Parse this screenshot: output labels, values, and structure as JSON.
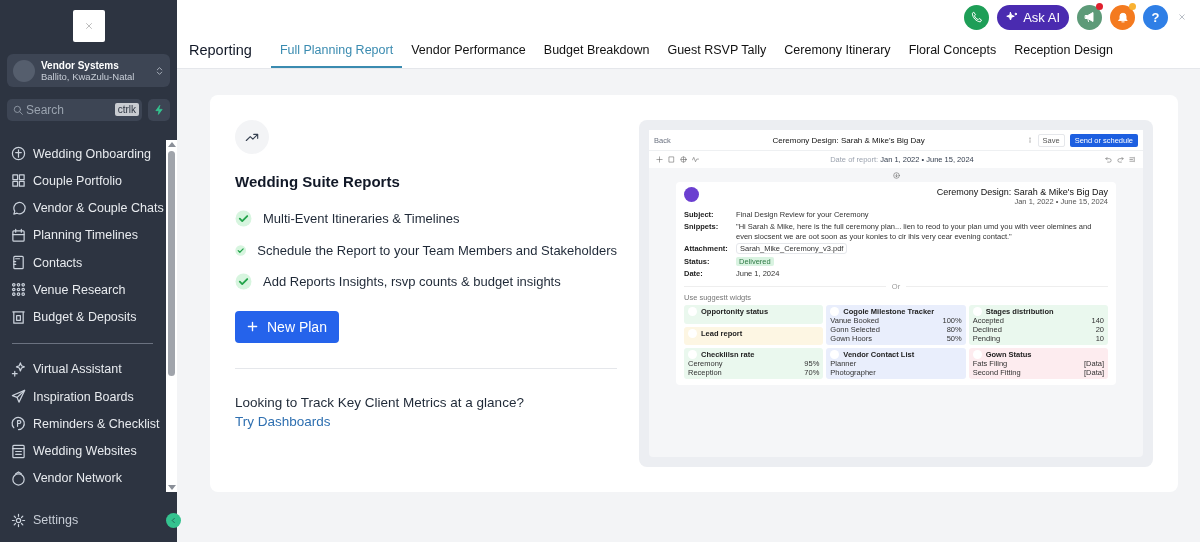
{
  "account": {
    "name": "Vendor Systems",
    "location": "Ballito, KwaZulu-Natal"
  },
  "search": {
    "placeholder": "Search",
    "shortcut": "ctrlk"
  },
  "nav": [
    {
      "items": [
        {
          "kind": "onboarding",
          "label": "Wedding Onboarding"
        },
        {
          "kind": "grid",
          "label": "Couple Portfolio"
        },
        {
          "kind": "chat",
          "label": "Vendor & Couple Chats"
        },
        {
          "kind": "calendar",
          "label": "Planning Timelines"
        },
        {
          "kind": "notebook",
          "label": "Contacts"
        },
        {
          "kind": "dots",
          "label": "Venue Research"
        },
        {
          "kind": "box",
          "label": "Budget & Deposits"
        }
      ]
    },
    {
      "items": [
        {
          "kind": "sparkle",
          "label": "Virtual Assistant"
        },
        {
          "kind": "send",
          "label": "Inspiration Boards"
        },
        {
          "kind": "clock",
          "label": "Reminders & Checklist"
        },
        {
          "kind": "page",
          "label": "Wedding Websites"
        },
        {
          "kind": "ring",
          "label": "Vendor Network"
        }
      ]
    }
  ],
  "settings": {
    "label": "Settings"
  },
  "actions": [
    {
      "kind": "phone"
    },
    {
      "kind": "ask_ai",
      "label": "Ask AI"
    },
    {
      "kind": "megaphone",
      "dot": true
    },
    {
      "kind": "bell",
      "dot": true
    },
    {
      "kind": "help",
      "label": "?"
    }
  ],
  "tabs": {
    "title": "Reporting",
    "items": [
      {
        "label": "Full Planning Report",
        "selected": true
      },
      {
        "label": "Vendor Performance",
        "selected": false
      },
      {
        "label": "Budget Breakdown",
        "selected": false
      },
      {
        "label": "Guest RSVP Tally",
        "selected": false
      },
      {
        "label": "Ceremony Itinerary",
        "selected": false
      },
      {
        "label": "Floral Concepts",
        "selected": false
      },
      {
        "label": "Reception Design",
        "selected": false
      }
    ]
  },
  "intro": {
    "heading": "Wedding Suite Reports",
    "features": [
      "Multi-Event Itineraries & Timelines",
      "Schedule the Report to your Team Members and Stakeholders",
      "Add Reports Insights, rsvp counts & budget insights"
    ],
    "button": "New Plan",
    "prompt": "Looking to Track Key Client Metrics at a glance?",
    "link": "Try Dashboards"
  },
  "preview": {
    "back": "Back",
    "title": "Ceremony Design: Sarah & Mike's Big Day",
    "save": "Save",
    "send": "Send or schedule",
    "date_label": "Date of report:",
    "date_range": "Jan 1, 2022 • June 15, 2024",
    "card": {
      "title": "Ceremony Design: Sarah & Mike's Big Day",
      "date_range": "Jan 1, 2022 • June 15, 2024",
      "fields": [
        {
          "kind": "text",
          "label": "Subject:",
          "value": "Final Design Review for your Ceremony"
        },
        {
          "kind": "text",
          "label": "Snippets:",
          "value": "\"Hi Sarah & Mike, here is the full ceremony plan... lien to reod to your plan umd you with veer olemines and even siocsent we are oot soon as your konies to cir ihis very cear evening contact.\""
        },
        {
          "kind": "file",
          "label": "Attachment:",
          "value": "Sarah_Mike_Ceremony_v3.pdf"
        },
        {
          "kind": "badge",
          "label": "Status:",
          "value": "Delivered"
        },
        {
          "kind": "text",
          "label": "Date:",
          "value": "June 1, 2024"
        }
      ],
      "divider": "Or",
      "widgets_label": "Use suggestt widgts",
      "widgets": [
        {
          "kind": "short",
          "title": "Opportonity status",
          "color": "#eaf8ee"
        },
        {
          "kind": "tall",
          "title": "Cogole Milestone Tracker",
          "color": "#e9eefc",
          "rows": [
            {
              "name": "Vanue Booked",
              "value": "100%"
            },
            {
              "name": "Gonn Selected",
              "value": "80%"
            },
            {
              "name": "Gown Hoors",
              "value": "50%"
            }
          ]
        },
        {
          "kind": "tall",
          "title": "Stages distribution",
          "color": "#eaf8ee",
          "rows": [
            {
              "name": "Accepted",
              "value": "140"
            },
            {
              "name": "Declined",
              "value": "20"
            },
            {
              "name": "Pending",
              "value": "10"
            }
          ]
        },
        {
          "kind": "short",
          "title": "Lead report",
          "color": "#fdf6e3"
        },
        {
          "kind": "normal",
          "title": "Checklilsn rate",
          "color": "#eaf8ee",
          "rows": [
            {
              "name": "Ceremony",
              "value": "95%"
            },
            {
              "name": "Reception",
              "value": "70%"
            }
          ]
        },
        {
          "kind": "normal",
          "title": "Vendor Contact List",
          "color": "#e9eefc",
          "rows": [
            {
              "name": "Planner"
            },
            {
              "name": "Photographer"
            }
          ]
        },
        {
          "kind": "normal",
          "title": "Gown Status",
          "color": "#fdecef",
          "rows": [
            {
              "name": "Fats Filing",
              "value": "[Data]"
            },
            {
              "name": "Second Fitting",
              "value": "[Data]"
            }
          ]
        }
      ]
    }
  }
}
